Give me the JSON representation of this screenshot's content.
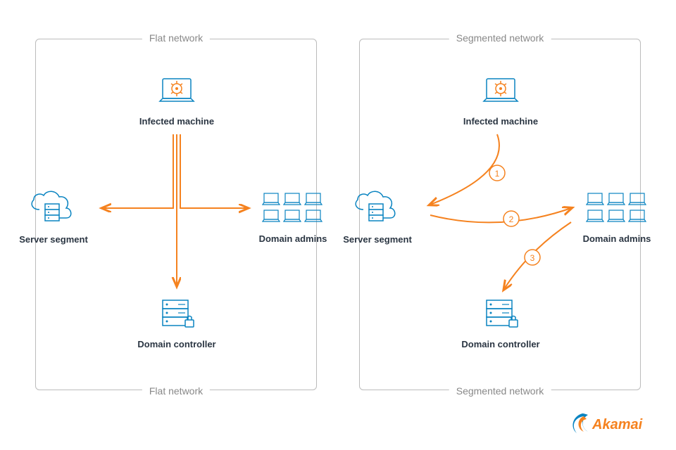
{
  "left": {
    "title_top": "Flat network",
    "title_bottom": "Flat network",
    "infected": "Infected machine",
    "server": "Server segment",
    "admins": "Domain admins",
    "controller": "Domain controller"
  },
  "right": {
    "title_top": "Segmented network",
    "title_bottom": "Segmented  network",
    "infected": "Infected machine",
    "server": "Server segment",
    "admins": "Domain admins",
    "controller": "Domain controller",
    "step1": "1",
    "step2": "2",
    "step3": "3"
  },
  "brand": "Akamai",
  "colors": {
    "blue": "#0a84c1",
    "orange": "#f5821f",
    "gray": "#999",
    "text": "#2a3542"
  }
}
